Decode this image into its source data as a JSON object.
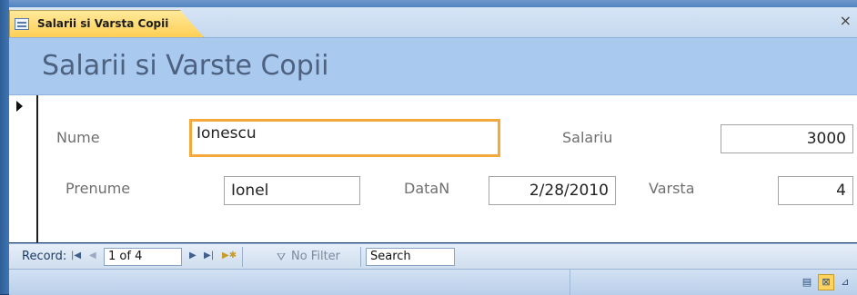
{
  "tab": {
    "label": "Salarii si Varsta Copii",
    "icon": "form-icon",
    "close_label": "×"
  },
  "form": {
    "title": "Salarii si Varste Copii",
    "fields": {
      "nume": {
        "label": "Nume",
        "value": "Ionescu"
      },
      "prenume": {
        "label": "Prenume",
        "value": "Ionel"
      },
      "salariu": {
        "label": "Salariu",
        "value": "3000"
      },
      "datan": {
        "label": "DataN",
        "value": "2/28/2010"
      },
      "varsta": {
        "label": "Varsta",
        "value": "4"
      }
    }
  },
  "navigator": {
    "record_label": "Record:",
    "current": "1 of 4",
    "filter_label": "No Filter",
    "search_label": "Search"
  },
  "colors": {
    "header_bg": "#a9c9ee",
    "tab_active": "#ffd35e",
    "focus_border": "#f5a93c"
  }
}
